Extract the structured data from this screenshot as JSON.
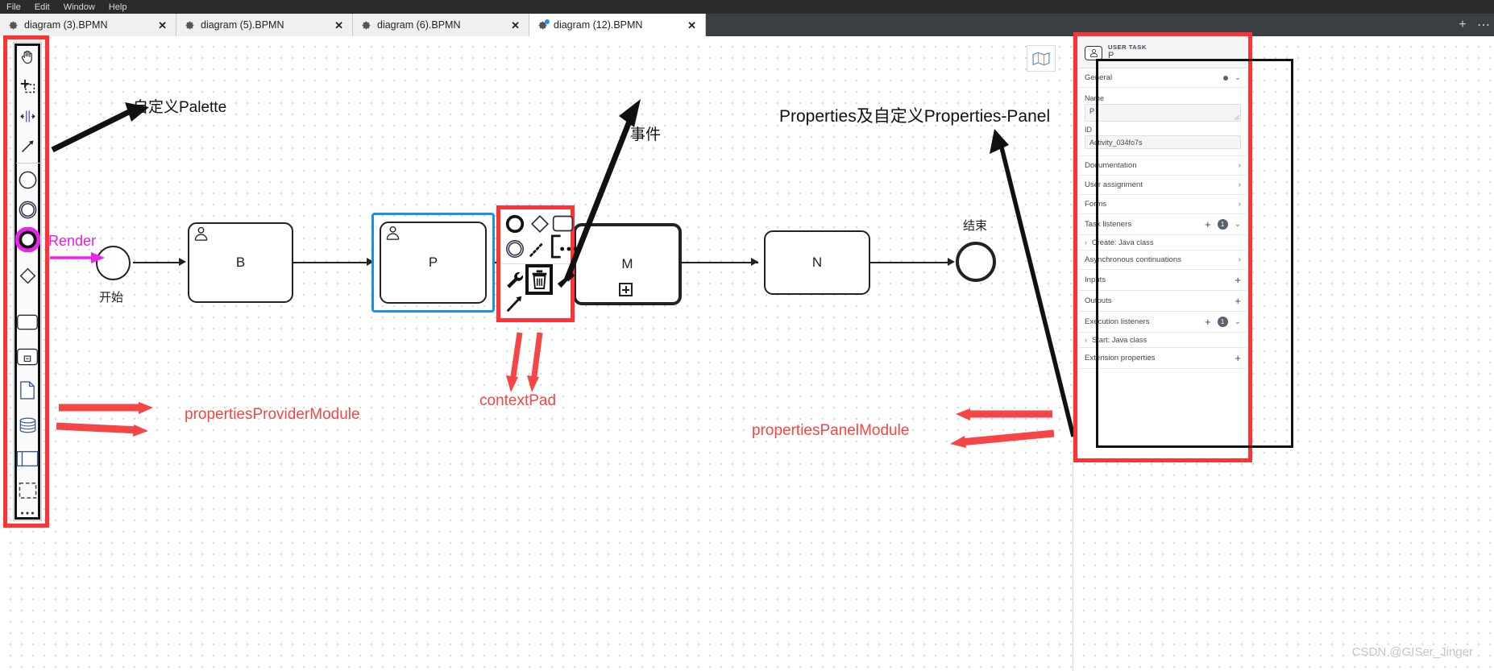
{
  "menubar": {
    "items": [
      "File",
      "Edit",
      "Window",
      "Help"
    ]
  },
  "tabs": [
    {
      "label": "diagram (3).BPMN",
      "icon": "gear-icon",
      "active": false,
      "dirty": false,
      "close": "✕"
    },
    {
      "label": "diagram (5).BPMN",
      "icon": "gear-icon",
      "active": false,
      "dirty": false,
      "close": "✕"
    },
    {
      "label": "diagram (6).BPMN",
      "icon": "gear-icon",
      "active": false,
      "dirty": false,
      "close": "✕"
    },
    {
      "label": "diagram (12).BPMN",
      "icon": "gear-icon",
      "active": true,
      "dirty": true,
      "close": "✕"
    }
  ],
  "tabbar_actions": {
    "add": "+",
    "more": "⋯"
  },
  "palette": {
    "items": [
      {
        "name": "hand-tool-icon"
      },
      {
        "name": "lasso-tool-icon"
      },
      {
        "name": "space-tool-icon"
      },
      {
        "name": "global-connect-tool-icon"
      },
      {
        "name": "start-event-icon"
      },
      {
        "name": "intermediate-event-icon"
      },
      {
        "name": "end-event-icon-highlighted"
      },
      {
        "name": "gateway-icon"
      },
      {
        "name": "task-icon"
      },
      {
        "name": "subprocess-icon"
      },
      {
        "name": "data-object-icon"
      },
      {
        "name": "data-store-icon"
      },
      {
        "name": "participant-icon"
      },
      {
        "name": "group-icon"
      },
      {
        "name": "more-icon"
      }
    ]
  },
  "canvas": {
    "minimap_button": "map-icon",
    "shapes": [
      {
        "id": "start",
        "type": "start-event",
        "label": "开始"
      },
      {
        "id": "task-b",
        "type": "user-task",
        "label": "B"
      },
      {
        "id": "task-p",
        "type": "user-task",
        "label": "P",
        "selected": true
      },
      {
        "id": "task-m",
        "type": "subprocess",
        "label": "M"
      },
      {
        "id": "task-n",
        "type": "task",
        "label": "N"
      },
      {
        "id": "end",
        "type": "end-event",
        "label": "结束"
      }
    ]
  },
  "context_pad": {
    "items": [
      {
        "name": "append-end-event-icon"
      },
      {
        "name": "append-gateway-icon"
      },
      {
        "name": "append-task-icon"
      },
      {
        "name": "append-intermediate-event-icon"
      },
      {
        "name": "connect-icon"
      },
      {
        "name": "append-text-annotation-icon"
      },
      {
        "name": "more-options-icon"
      },
      {
        "name": "wrench-icon"
      },
      {
        "name": "delete-icon"
      },
      {
        "name": "set-color-icon"
      },
      {
        "name": "connect-arrow-icon"
      }
    ]
  },
  "annotations": [
    {
      "name": "anno-custom-palette",
      "text": "自定义Palette",
      "color": "#111111"
    },
    {
      "name": "anno-render",
      "text": "Render",
      "color": "#e61ae6"
    },
    {
      "name": "anno-event",
      "text": "事件",
      "color": "#111111"
    },
    {
      "name": "anno-properties-panel",
      "text": "Properties及自定义Properties-Panel",
      "color": "#111111"
    },
    {
      "name": "anno-properties-provider",
      "text": "propertiesProviderModule",
      "color": "#f54545"
    },
    {
      "name": "anno-context-pad",
      "text": "contextPad",
      "color": "#f54545"
    },
    {
      "name": "anno-properties-panel-module",
      "text": "propertiesPanelModule",
      "color": "#f54545"
    }
  ],
  "properties_panel": {
    "type_label": "USER TASK",
    "element_name": "P",
    "element_icon": "user-task-icon",
    "general": {
      "title": "General",
      "chevron": "⌄",
      "name_label": "Name",
      "name_value": "P",
      "id_label": "ID",
      "id_value": "Activity_034fo7s"
    },
    "groups": [
      {
        "name": "documentation",
        "label": "Documentation",
        "chevron": "›"
      },
      {
        "name": "user-assignment",
        "label": "User assignment",
        "chevron": "›"
      },
      {
        "name": "forms",
        "label": "Forms",
        "chevron": "›"
      },
      {
        "name": "task-listeners",
        "label": "Task listeners",
        "plus": "+",
        "badge": "1",
        "chevron": "⌄",
        "entries": [
          {
            "label": "Create: Java class",
            "chevron": "›"
          }
        ]
      },
      {
        "name": "async-continuations",
        "label": "Asynchronous continuations",
        "chevron": "›"
      },
      {
        "name": "inputs",
        "label": "Inputs",
        "plus": "+"
      },
      {
        "name": "outputs",
        "label": "Outputs",
        "plus": "+"
      },
      {
        "name": "execution-listeners",
        "label": "Execution listeners",
        "plus": "+",
        "badge": "1",
        "chevron": "⌄",
        "entries": [
          {
            "label": "Start: Java class",
            "chevron": "›"
          }
        ]
      },
      {
        "name": "extension-properties",
        "label": "Extension properties",
        "plus": "+"
      }
    ]
  },
  "watermark": "CSDN @GISer_Jinger",
  "colors": {
    "accent_red": "#ff3333",
    "anno_red": "#f54545",
    "magenta": "#e61ae6",
    "selection_blue": "#1c90e8",
    "menubar_bg": "#2b2b2b",
    "tabbar_bg": "#3c3f41"
  }
}
